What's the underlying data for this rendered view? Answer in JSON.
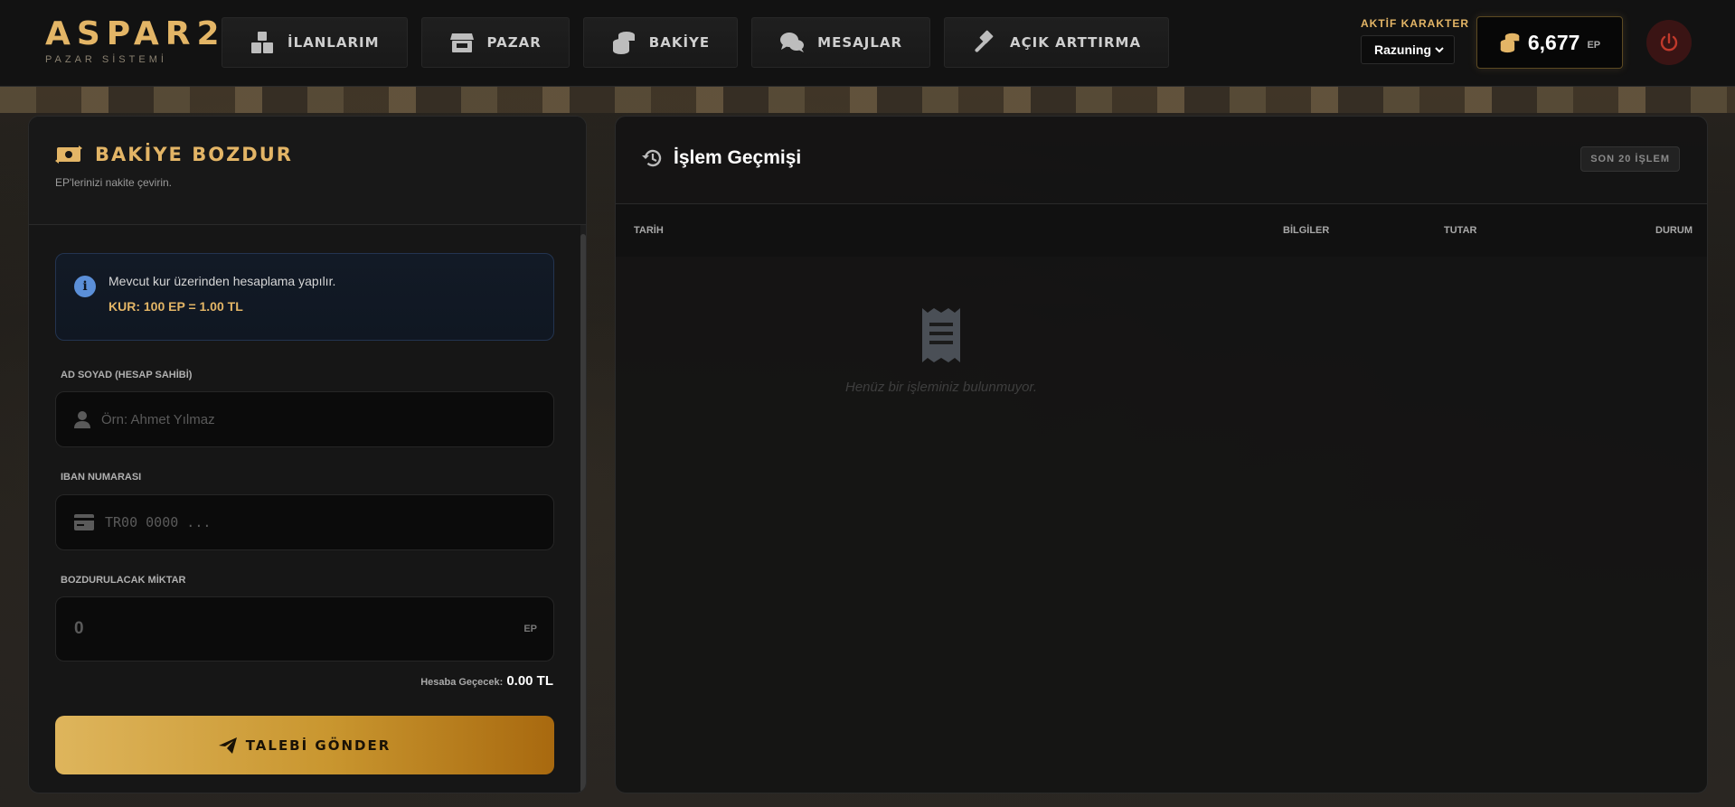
{
  "brand": {
    "title": "ASPAR2",
    "subtitle": "PAZAR SİSTEMİ"
  },
  "nav": {
    "items": [
      {
        "label": "İLANLARIM",
        "icon": "boxes-icon"
      },
      {
        "label": "PAZAR",
        "icon": "store-icon"
      },
      {
        "label": "BAKİYE",
        "icon": "coins-icon"
      },
      {
        "label": "MESAJLAR",
        "icon": "comments-icon"
      },
      {
        "label": "AÇIK ARTTIRMA",
        "icon": "gavel-icon"
      }
    ]
  },
  "character": {
    "label": "AKTİF KARAKTER",
    "selected": "Razuning"
  },
  "balance": {
    "value": "6,677",
    "unit": "EP"
  },
  "colors": {
    "accent": "#e3b566",
    "info": "#5b8fd8",
    "danger": "#c0392b"
  },
  "withdraw": {
    "title": "BAKİYE BOZDUR",
    "subtitle": "EP'lerinizi nakite çevirin.",
    "info_text": "Mevcut kur üzerinden hesaplama yapılır.",
    "rate_text": "KUR: 100 EP = 1.00 TL",
    "name_label": "AD SOYAD (HESAP SAHİBİ)",
    "name_placeholder": "Örn: Ahmet Yılmaz",
    "iban_label": "IBAN NUMARASI",
    "iban_placeholder": "TR00 0000 ...",
    "amount_label": "BOZDURULACAK MİKTAR",
    "amount_value": "0",
    "amount_unit": "EP",
    "receive_label": "Hesaba Geçecek:",
    "receive_value": "0.00 TL",
    "submit_label": "TALEBİ GÖNDER"
  },
  "history": {
    "title": "İşlem Geçmişi",
    "badge": "SON 20 İŞLEM",
    "columns": [
      "TARİH",
      "BİLGİLER",
      "TUTAR",
      "DURUM"
    ],
    "empty_text": "Henüz bir işleminiz bulunmuyor."
  }
}
